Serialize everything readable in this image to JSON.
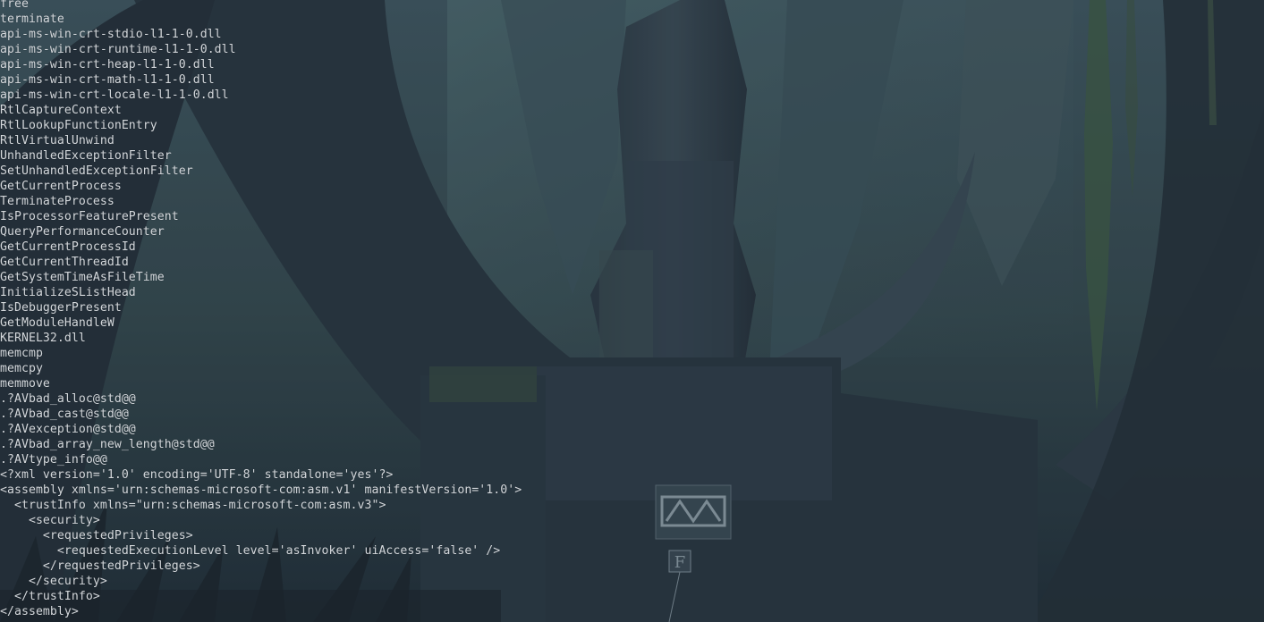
{
  "terminal": {
    "lines": [
      "free",
      "terminate",
      "api-ms-win-crt-stdio-l1-1-0.dll",
      "api-ms-win-crt-runtime-l1-1-0.dll",
      "api-ms-win-crt-heap-l1-1-0.dll",
      "api-ms-win-crt-math-l1-1-0.dll",
      "api-ms-win-crt-locale-l1-1-0.dll",
      "RtlCaptureContext",
      "RtlLookupFunctionEntry",
      "RtlVirtualUnwind",
      "UnhandledExceptionFilter",
      "SetUnhandledExceptionFilter",
      "GetCurrentProcess",
      "TerminateProcess",
      "IsProcessorFeaturePresent",
      "QueryPerformanceCounter",
      "GetCurrentProcessId",
      "GetCurrentThreadId",
      "GetSystemTimeAsFileTime",
      "InitializeSListHead",
      "IsDebuggerPresent",
      "GetModuleHandleW",
      "KERNEL32.dll",
      "memcmp",
      "memcpy",
      "memmove",
      ".?AVbad_alloc@std@@",
      ".?AVbad_cast@std@@",
      ".?AVexception@std@@",
      ".?AVbad_array_new_length@std@@",
      ".?AVtype_info@@",
      "<?xml version='1.0' encoding='UTF-8' standalone='yes'?>",
      "<assembly xmlns='urn:schemas-microsoft-com:asm.v1' manifestVersion='1.0'>",
      "  <trustInfo xmlns=\"urn:schemas-microsoft-com:asm.v3\">",
      "    <security>",
      "      <requestedPrivileges>",
      "        <requestedExecutionLevel level='asInvoker' uiAccess='false' />",
      "      </requestedPrivileges>",
      "    </security>",
      "  </trustInfo>",
      "</assembly>"
    ]
  },
  "wallpaper": {
    "sticker_letter": "F"
  },
  "colors": {
    "terminal_text": "#d4d8dc",
    "wallpaper_base": "#2b3a44"
  }
}
